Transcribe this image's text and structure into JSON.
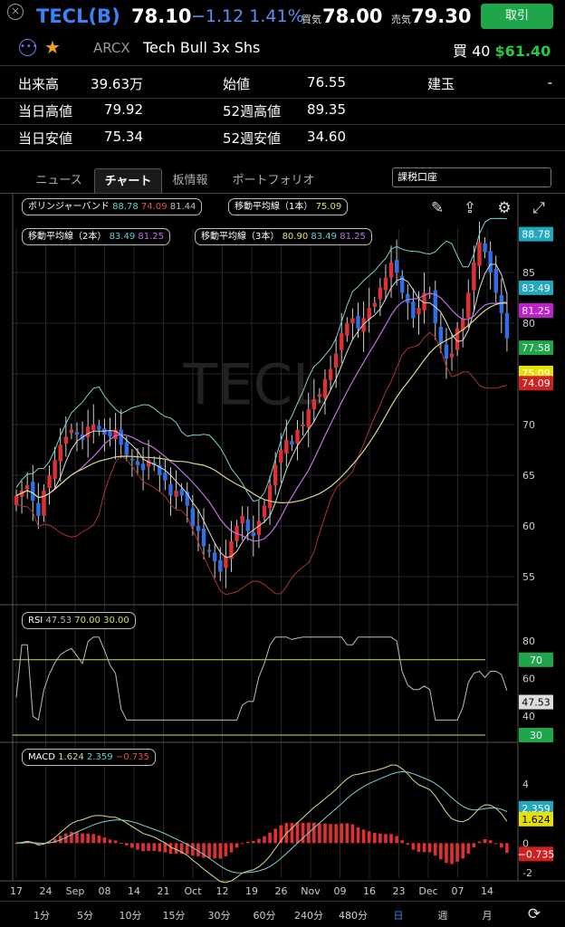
{
  "header": {
    "close_glyph": "×",
    "symbol": "TECL(B)",
    "last": "78.10",
    "change": "−1.12 1.41%",
    "bid_label": "買気",
    "bid": "78.00",
    "ask_label": "売気",
    "ask": "79.30",
    "trade_button": "取引",
    "more_glyph": "•••",
    "star_glyph": "★",
    "exchange": "ARCX",
    "name": "Tech Bull 3x Shs",
    "position_label": "買 40",
    "position_pnl": "$61.40"
  },
  "stats": [
    {
      "label": "出来高",
      "value": "39.63万"
    },
    {
      "label": "始値",
      "value": "76.55"
    },
    {
      "label": "建玉",
      "value": "-"
    },
    {
      "label": "当日高値",
      "value": "79.92"
    },
    {
      "label": "52週高値",
      "value": "89.35"
    },
    {
      "label": "当日安値",
      "value": "75.34"
    },
    {
      "label": "52週安値",
      "value": "34.60"
    }
  ],
  "tabs": [
    "ニュース",
    "チャート",
    "板情報",
    "ポートフォリオ"
  ],
  "active_tab": 1,
  "account": "課税口座",
  "indicators": {
    "bollinger": {
      "name": "ボリンジャーバンド",
      "v1": "88.78",
      "v2": "74.09",
      "v3": "81.44"
    },
    "ma1": {
      "name": "移動平均線（1本）",
      "v1": "75.09"
    },
    "ma2": {
      "name": "移動平均線（2本）",
      "v1": "83.49",
      "v2": "81.25"
    },
    "ma3": {
      "name": "移動平均線（3本）",
      "v1": "80.90",
      "v2": "83.49",
      "v3": "81.25"
    },
    "rsi": {
      "name": "RSI",
      "v1": "47.53",
      "v2": "70.00",
      "v3": "30.00"
    },
    "macd": {
      "name": "MACD",
      "v1": "1.624",
      "v2": "2.359",
      "v3": "−0.735"
    }
  },
  "watermark": "TECL",
  "colors": {
    "up": "#e03030",
    "down": "#2f6fe8",
    "accent": "#3b82f6",
    "green": "#1fa64a",
    "upper_band": "#7fd0d0",
    "ma_purple": "#c070e0",
    "ma_yellow": "#d8d890",
    "lower_band": "#b03030"
  },
  "chart_data": {
    "type": "candlestick",
    "price_axis": {
      "ticks": [
        "85",
        "80",
        "75",
        "70",
        "65",
        "60",
        "55"
      ],
      "ylim": [
        50,
        90
      ]
    },
    "price_badges": [
      {
        "text": "88.78",
        "value": 88.78,
        "color": "#1fa8c0"
      },
      {
        "text": "83.49",
        "value": 83.49,
        "color": "#1fa8c0"
      },
      {
        "text": "81.25",
        "value": 81.25,
        "color": "#c020d0"
      },
      {
        "text": "77.58",
        "value": 77.58,
        "color": "#1fa64a"
      },
      {
        "text": "75.09",
        "value": 75.09,
        "color": "#e8e000"
      },
      {
        "text": "74.09",
        "value": 74.09,
        "color": "#d02020"
      }
    ],
    "x_labels": [
      "17",
      "24",
      "Sep",
      "08",
      "14",
      "21",
      "Oct",
      "12",
      "19",
      "26",
      "Nov",
      "09",
      "16",
      "23",
      "Dec",
      "07",
      "14"
    ],
    "close": [
      63,
      63.5,
      64,
      62.5,
      61,
      63.5,
      65,
      66.5,
      68,
      68.8,
      69.5,
      69,
      68.5,
      69.8,
      70,
      69.5,
      69,
      68.8,
      69.5,
      68,
      67,
      66.5,
      66,
      65.5,
      66.5,
      66,
      65,
      64.5,
      63,
      63.5,
      63,
      62,
      60,
      59.5,
      58,
      57.5,
      56.5,
      55.5,
      57,
      58.5,
      60,
      61,
      59.5,
      59,
      60.5,
      62,
      64,
      66,
      67.5,
      68.5,
      68,
      69.5,
      70,
      71.5,
      72.5,
      73,
      74.5,
      75.5,
      77,
      79,
      80,
      80.5,
      79.5,
      80.5,
      81.5,
      82,
      83.5,
      84.5,
      86,
      85,
      83,
      82,
      80.5,
      81.5,
      83,
      83,
      80,
      78,
      76.5,
      77,
      79.5,
      80.5,
      83,
      86,
      88,
      87,
      85,
      83,
      81,
      78.5
    ],
    "rsi": {
      "ticks": [
        "80",
        "60",
        "40"
      ],
      "levels": [
        70,
        30
      ],
      "last": "47.53"
    },
    "macd": {
      "ticks": [
        "4",
        "2",
        "0",
        "-2"
      ],
      "ylim": [
        -2.3,
        4.6
      ]
    }
  },
  "timeframes": [
    "1分",
    "5分",
    "10分",
    "15分",
    "30分",
    "60分",
    "240分",
    "480分",
    "日",
    "週",
    "月"
  ],
  "active_timeframe": 8
}
